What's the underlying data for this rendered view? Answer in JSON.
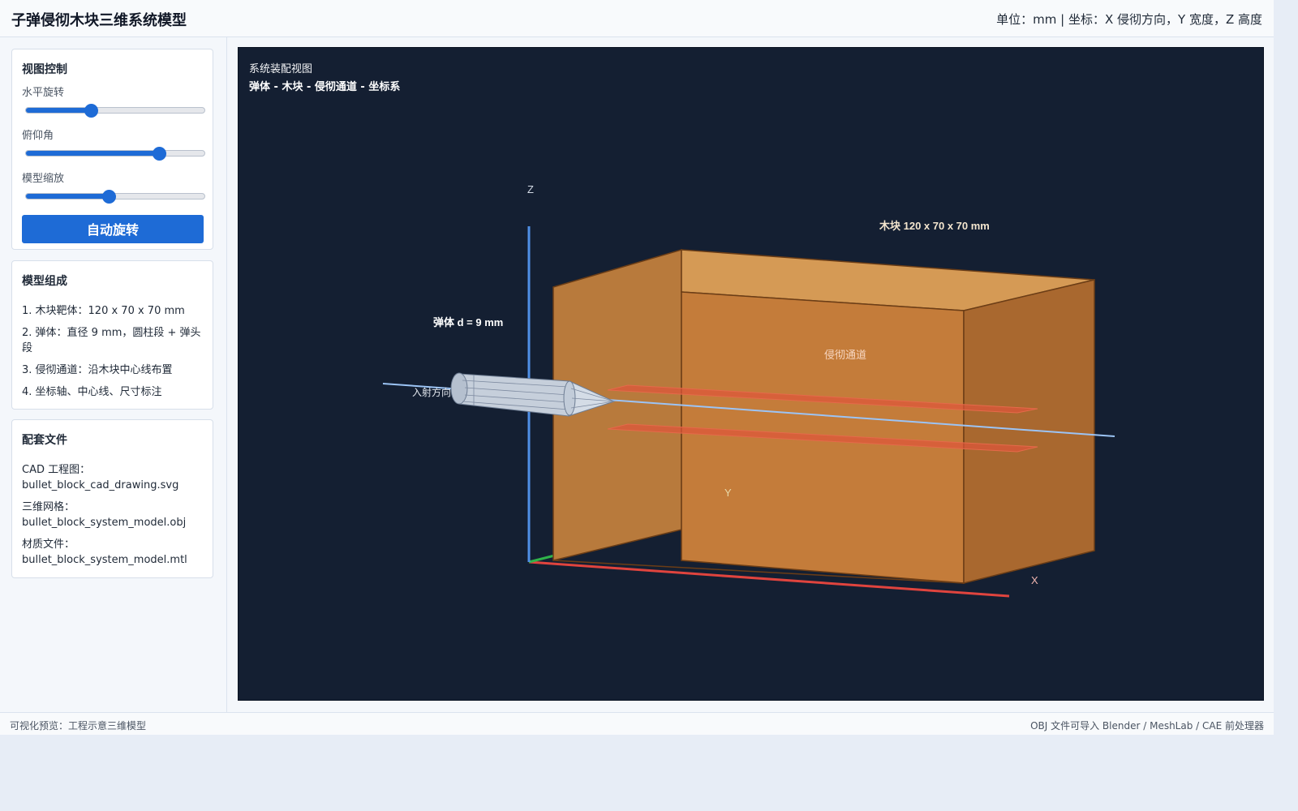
{
  "header": {
    "title": "子弹侵彻木块三维系统模型",
    "units": "单位：mm | 坐标：X 侵彻方向，Y 宽度，Z 高度"
  },
  "view_control": {
    "title": "视图控制",
    "sliders": [
      {
        "label": "水平旋转",
        "value_pct": 36
      },
      {
        "label": "俯仰角",
        "value_pct": 74
      },
      {
        "label": "模型缩放",
        "value_pct": 46
      }
    ],
    "auto_rotate_label": "自动旋转",
    "accent_color": "#1e6bd6"
  },
  "composition": {
    "title": "模型组成",
    "items": [
      "1. 木块靶体：120 x 70 x 70 mm",
      "2. 弹体：直径 9 mm，圆柱段 + 弹头段",
      "3. 侵彻通道：沿木块中心线布置",
      "4. 坐标轴、中心线、尺寸标注"
    ]
  },
  "files": {
    "title": "配套文件",
    "entries": [
      {
        "label": "CAD 工程图：",
        "name": "bullet_block_cad_drawing.svg"
      },
      {
        "label": "三维网格：",
        "name": "bullet_block_system_model.obj"
      },
      {
        "label": "材质文件：",
        "name": "bullet_block_system_model.mtl"
      }
    ]
  },
  "viewport": {
    "subtitle": "系统装配视图",
    "title": "弹体 - 木块 - 侵彻通道 - 坐标系",
    "background": "#141f32",
    "labels": {
      "z_axis": "Z",
      "y_axis": "Y",
      "x_axis": "X",
      "block_dim": "木块 120 x 70 x 70 mm",
      "bullet_dim": "弹体 d = 9 mm",
      "channel": "侵彻通道",
      "incident": "入射方向"
    },
    "colors": {
      "x_axis": "#e0443e",
      "y_axis": "#2fb34a",
      "z_axis": "#4f8fe6",
      "wood_front": "#c47c3a",
      "wood_top": "#d59a55",
      "wood_side": "#a9682f",
      "channel": "#e0543a",
      "centerline": "#9cc4f5"
    }
  },
  "status": {
    "left": "可视化预览：工程示意三维模型",
    "right": "OBJ 文件可导入 Blender / MeshLab / CAE 前处理器"
  }
}
